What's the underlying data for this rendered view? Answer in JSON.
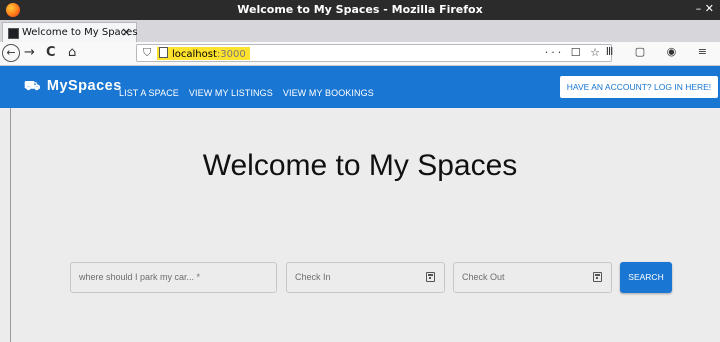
{
  "window": {
    "title": "Welcome to My Spaces - Mozilla Firefox",
    "controls": "– ✕"
  },
  "tab": {
    "label": "Welcome to My Spaces",
    "close": "×",
    "new": "+"
  },
  "nav": {
    "back": "←",
    "forward": "→",
    "reload": "C",
    "home": "⌂"
  },
  "url": {
    "host": "localhost",
    "port": ":3000",
    "actions": "··· ☐ ☆"
  },
  "toolbar_right": "Ⅲ ▢ ◉ ≡",
  "app": {
    "brand": "MySpaces",
    "links": [
      "LIST A SPACE",
      "VIEW MY LISTINGS",
      "VIEW MY BOOKINGS"
    ],
    "login": "HAVE AN ACCOUNT? LOG IN HERE!"
  },
  "main": {
    "headline": "Welcome to My Spaces",
    "search_placeholder": "where should I park my car... *",
    "check_in": "Check In",
    "check_out": "Check Out",
    "search_button": "SEARCH"
  }
}
